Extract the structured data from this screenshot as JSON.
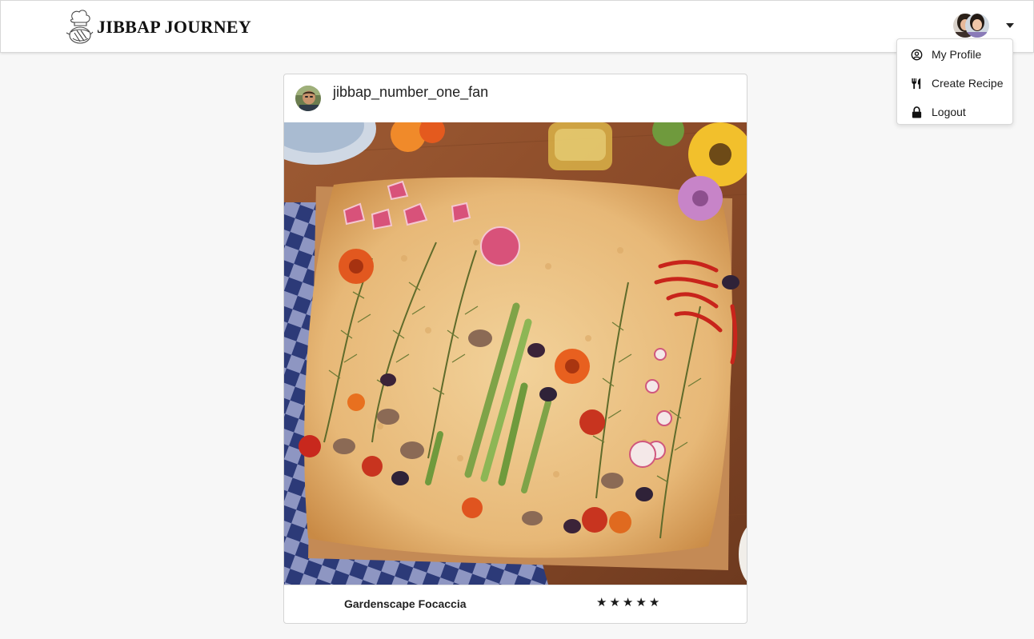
{
  "navbar": {
    "brand_name": "JIBBAP JOURNEY",
    "logo_icon": "chef-hat-pot-logo",
    "avatar_icon": "user-avatar-photo",
    "caret_icon": "caret-down-icon"
  },
  "dropdown": {
    "items": [
      {
        "label": "My Profile",
        "icon": "user-circle-icon"
      },
      {
        "label": "Create Recipe",
        "icon": "utensils-icon"
      },
      {
        "label": "Logout",
        "icon": "lock-icon"
      }
    ]
  },
  "post": {
    "author": "jibbap_number_one_fan",
    "image_subject": "focaccia-photo",
    "recipe_title": "Gardenscape Focaccia",
    "rating": 5,
    "rating_max": 5,
    "star_char": "★"
  },
  "colors": {
    "background": "#f7f7f7",
    "card": "#ffffff",
    "text": "#222222"
  }
}
